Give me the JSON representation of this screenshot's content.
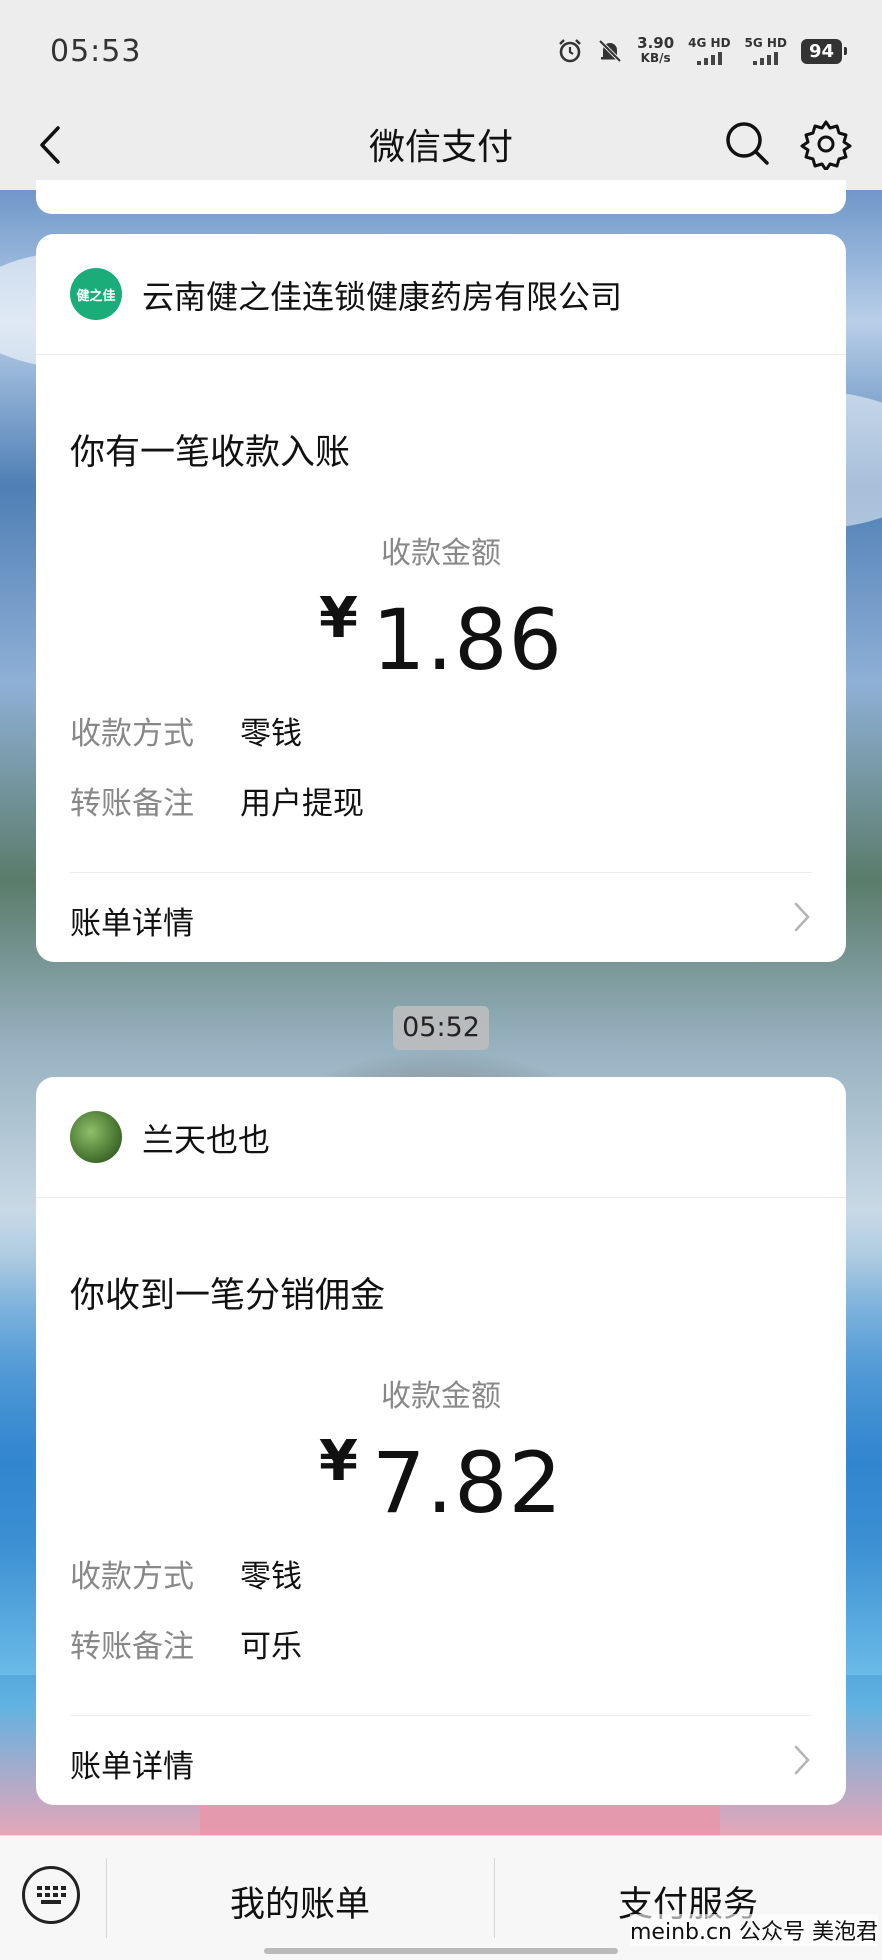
{
  "status_bar": {
    "time": "05:53",
    "net_speed_value": "3.90",
    "net_speed_unit": "KB/s",
    "sim1": "4G HD",
    "sim2": "5G HD",
    "battery": "94",
    "icons": [
      "alarm-icon",
      "mute-bell-icon",
      "signal-icon",
      "battery-icon"
    ]
  },
  "nav": {
    "title": "微信支付",
    "icons": [
      "back-arrow-icon",
      "search-icon",
      "gear-icon"
    ]
  },
  "messages": [
    {
      "merchant": "云南健之佳连锁健康药房有限公司",
      "avatar_text": "健之佳",
      "heading": "你有一笔收款入账",
      "amount_label": "收款金额",
      "currency": "¥",
      "amount": "1.86",
      "rows": [
        {
          "key": "收款方式",
          "value": "零钱"
        },
        {
          "key": "转账备注",
          "value": "用户提现"
        }
      ],
      "detail": "账单详情"
    },
    {
      "merchant": "兰天也也",
      "heading": "你收到一笔分销佣金",
      "amount_label": "收款金额",
      "currency": "¥",
      "amount": "7.82",
      "rows": [
        {
          "key": "收款方式",
          "value": "零钱"
        },
        {
          "key": "转账备注",
          "value": "可乐"
        }
      ],
      "detail": "账单详情"
    }
  ],
  "time_separator": "05:52",
  "bottom_bar": {
    "my_bill": "我的账单",
    "pay_service": "支付服务",
    "keyboard_icon": "keyboard-icon"
  },
  "watermark": "meinb.cn  公众号 美泡君",
  "colors": {
    "background": "#ededed",
    "card": "#ffffff",
    "muted_text": "#888888",
    "merchant_avatar_green": "#1aad7a"
  }
}
